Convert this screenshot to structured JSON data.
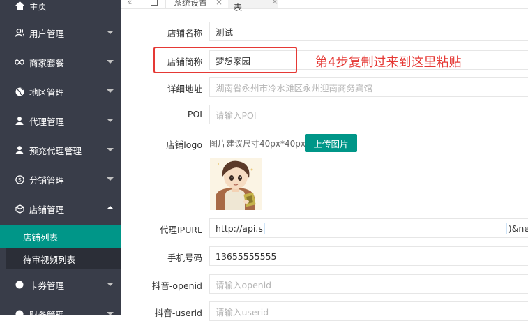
{
  "sidebar": {
    "home": "主页",
    "items": [
      {
        "label": "用户管理",
        "icon": "user-group-icon"
      },
      {
        "label": "商家套餐",
        "icon": "infinity-icon"
      },
      {
        "label": "地区管理",
        "icon": "globe-icon"
      },
      {
        "label": "代理管理",
        "icon": "user-icon"
      },
      {
        "label": "预充代理管理",
        "icon": "user-icon"
      },
      {
        "label": "分销管理",
        "icon": "dollar-circle-icon"
      },
      {
        "label": "店铺管理",
        "icon": "cube-icon"
      },
      {
        "label": "卡券管理",
        "icon": "circle-icon"
      },
      {
        "label": "财务管理",
        "icon": "circle-icon"
      }
    ],
    "sub_items": [
      {
        "label": "店铺列表",
        "active": true
      },
      {
        "label": "待审视频列表",
        "active": false
      }
    ]
  },
  "tabs": {
    "collapse": "«",
    "items": [
      {
        "label": "系统设置",
        "close": "×"
      },
      {
        "label": "店铺列表",
        "close": "×"
      }
    ]
  },
  "form": {
    "name_label": "店铺名称",
    "name_value": "测试",
    "short_label": "店铺简称",
    "short_value": "梦想家园",
    "address_label": "详细地址",
    "address_placeholder": "湖南省永州市冷水滩区永州迎南商务宾馆",
    "poi_label": "POI",
    "poi_placeholder": "请输入POI",
    "logo_label": "店铺logo",
    "logo_hint": "图片建议尺寸40px*40px",
    "upload_button": "上传图片",
    "proxy_label": "代理IPURL",
    "proxy_value_start": "http://api.s",
    "proxy_value_end": ")&ne",
    "phone_label": "手机号码",
    "phone_value": "13655555555",
    "douyin_openid_label": "抖音-openid",
    "douyin_openid_placeholder": "请输入openid",
    "douyin_userid_label": "抖音-userid",
    "douyin_userid_placeholder": "请输入userid"
  },
  "annotation": "第4步复制过来到这里粘贴",
  "colors": {
    "sidebar_bg": "#393d49",
    "active_green": "#009688",
    "annotation_red": "#e53935"
  }
}
